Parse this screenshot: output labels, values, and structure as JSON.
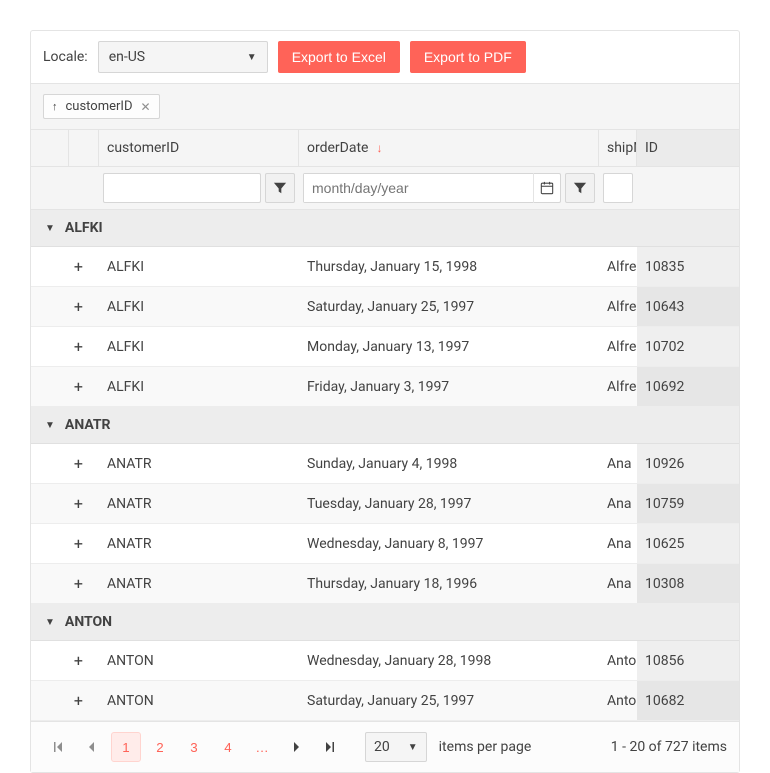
{
  "toolbar": {
    "locale_label": "Locale:",
    "locale_value": "en-US",
    "export_excel": "Export to Excel",
    "export_pdf": "Export to PDF"
  },
  "group_panel": {
    "chip_label": "customerID"
  },
  "header": {
    "customerID": "customerID",
    "orderDate": "orderDate",
    "shipName": "shipName",
    "id": "ID"
  },
  "filter": {
    "date_placeholder": "month/day/year"
  },
  "groups": [
    {
      "name": "ALFKI",
      "rows": [
        {
          "customer": "ALFKI",
          "orderDate": "Thursday, January 15, 1998",
          "shipName": "Alfreds",
          "id": "10835"
        },
        {
          "customer": "ALFKI",
          "orderDate": "Saturday, January 25, 1997",
          "shipName": "Alfreds",
          "id": "10643"
        },
        {
          "customer": "ALFKI",
          "orderDate": "Monday, January 13, 1997",
          "shipName": "Alfreds",
          "id": "10702"
        },
        {
          "customer": "ALFKI",
          "orderDate": "Friday, January 3, 1997",
          "shipName": "Alfreds",
          "id": "10692"
        }
      ]
    },
    {
      "name": "ANATR",
      "rows": [
        {
          "customer": "ANATR",
          "orderDate": "Sunday, January 4, 1998",
          "shipName": "Ana",
          "id": "10926"
        },
        {
          "customer": "ANATR",
          "orderDate": "Tuesday, January 28, 1997",
          "shipName": "Ana",
          "id": "10759"
        },
        {
          "customer": "ANATR",
          "orderDate": "Wednesday, January 8, 1997",
          "shipName": "Ana",
          "id": "10625"
        },
        {
          "customer": "ANATR",
          "orderDate": "Thursday, January 18, 1996",
          "shipName": "Ana",
          "id": "10308"
        }
      ]
    },
    {
      "name": "ANTON",
      "rows": [
        {
          "customer": "ANTON",
          "orderDate": "Wednesday, January 28, 1998",
          "shipName": "Antonio",
          "id": "10856"
        },
        {
          "customer": "ANTON",
          "orderDate": "Saturday, January 25, 1997",
          "shipName": "Antonio",
          "id": "10682"
        }
      ]
    }
  ],
  "pager": {
    "pages": [
      "1",
      "2",
      "3",
      "4",
      "…"
    ],
    "selected_page": "1",
    "page_size": "20",
    "page_size_label": "items per page",
    "info": "1 - 20 of 727 items"
  }
}
